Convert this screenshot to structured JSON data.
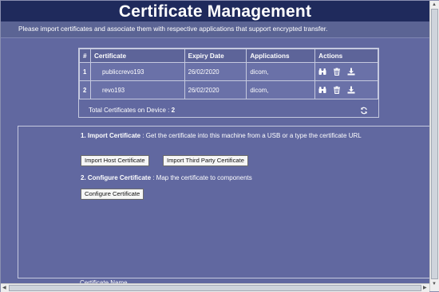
{
  "header": {
    "title": "Certificate Management",
    "subtitle": "Please import certificates and associate them with respective applications that support encrypted transfer."
  },
  "table": {
    "columns": [
      "#",
      "Certificate",
      "Expiry Date",
      "Applications",
      "Actions"
    ],
    "rows": [
      {
        "num": "1",
        "certificate": "publiccrevo193",
        "expiry": "26/02/2020",
        "applications": "dicom,"
      },
      {
        "num": "2",
        "certificate": "revo193",
        "expiry": "26/02/2020",
        "applications": "dicom,"
      }
    ],
    "total_label": "Total Certificates on Device :",
    "total_count": "2"
  },
  "import_section": {
    "step1_title": "1. Import Certificate",
    "step1_text": " : Get the certificate into this machine from a USB or a type the certificate URL",
    "import_host_label": "Import Host Certificate",
    "import_third_party_label": "Import Third Party Certificate",
    "step2_title": "2. Configure Certificate",
    "step2_text": " : Map the certificate to components",
    "configure_label": "Configure Certificate",
    "cert_name_label": "Certificate Name"
  },
  "icons": [
    "binoculars-icon",
    "trash-icon",
    "download-icon",
    "refresh-icon"
  ]
}
